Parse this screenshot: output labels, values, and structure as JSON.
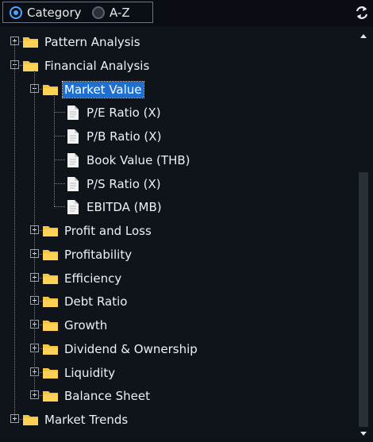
{
  "header": {
    "view_options": [
      {
        "label": "Category",
        "selected": true
      },
      {
        "label": "A-Z",
        "selected": false
      }
    ],
    "swap_icon": "swap-arrows-icon"
  },
  "tree": {
    "root_nodes": [
      {
        "label": "Pattern Analysis",
        "expanded": false
      },
      {
        "label": "Financial Analysis",
        "expanded": true,
        "children": [
          {
            "label": "Market Value",
            "expanded": true,
            "selected": true,
            "children": [
              {
                "label": "P/E Ratio (X)"
              },
              {
                "label": "P/B Ratio (X)"
              },
              {
                "label": "Book Value (THB)"
              },
              {
                "label": "P/S Ratio (X)"
              },
              {
                "label": "EBITDA (MB)"
              }
            ]
          },
          {
            "label": "Profit and Loss",
            "expanded": false
          },
          {
            "label": "Profitability",
            "expanded": false
          },
          {
            "label": "Efficiency",
            "expanded": false
          },
          {
            "label": "Debt Ratio",
            "expanded": false
          },
          {
            "label": "Growth",
            "expanded": false
          },
          {
            "label": "Dividend & Ownership",
            "expanded": false
          },
          {
            "label": "Liquidity",
            "expanded": false
          },
          {
            "label": "Balance Sheet",
            "expanded": false
          }
        ]
      },
      {
        "label": "Market Trends",
        "expanded": false
      }
    ]
  },
  "scrollbar": {
    "position_fraction": 0.34,
    "visible_fraction": 0.66
  },
  "colors": {
    "background": "#0f141b",
    "selection": "#1f6fd1",
    "radio_accent": "#4aa6ff",
    "folder": "#f4c542",
    "text": "#eef0f3"
  }
}
